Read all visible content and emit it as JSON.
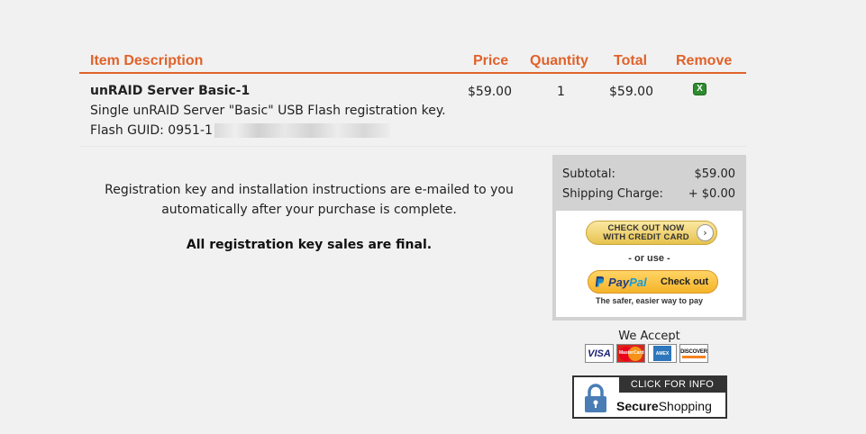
{
  "cart": {
    "headers": {
      "description": "Item Description",
      "price": "Price",
      "quantity": "Quantity",
      "total": "Total",
      "remove": "Remove"
    },
    "items": [
      {
        "name": "unRAID Server Basic-1",
        "description": "Single unRAID Server \"Basic\" USB Flash registration key.",
        "guid_prefix": "Flash GUID: 0951-1",
        "price": "$59.00",
        "quantity": "1",
        "total": "$59.00",
        "remove_label": "X"
      }
    ]
  },
  "info": {
    "line1": "Registration key and installation instructions are e-mailed to you",
    "line2": "automatically after your purchase is complete.",
    "final": "All registration key sales are final."
  },
  "summary": {
    "subtotal_label": "Subtotal:",
    "subtotal_value": "$59.00",
    "shipping_label": "Shipping Charge:",
    "shipping_value": "+ $0.00",
    "cc_button_line1": "CHECK OUT NOW",
    "cc_button_line2": "WITH CREDIT CARD",
    "or_use": "- or use -",
    "paypal_pay": "Pay",
    "paypal_pal": "Pal",
    "paypal_checkout": "Check out",
    "paypal_tagline": "The safer, easier way to pay"
  },
  "accept": {
    "label": "We Accept",
    "cards": [
      {
        "name": "VISA",
        "icon": "visa-card-icon"
      },
      {
        "name": "MasterCard",
        "icon": "mastercard-card-icon"
      },
      {
        "name": "AMEX",
        "icon": "amex-card-icon"
      },
      {
        "name": "DISCOVER",
        "icon": "discover-card-icon"
      }
    ]
  },
  "secure": {
    "click_info": "CLICK FOR INFO",
    "label_bold": "Secure",
    "label_rest": "Shopping"
  },
  "colors": {
    "accent": "#e0622a",
    "remove_green": "#2e8b2e",
    "summary_bg": "#d2d2d2",
    "page_bg": "#f1f1f1"
  }
}
